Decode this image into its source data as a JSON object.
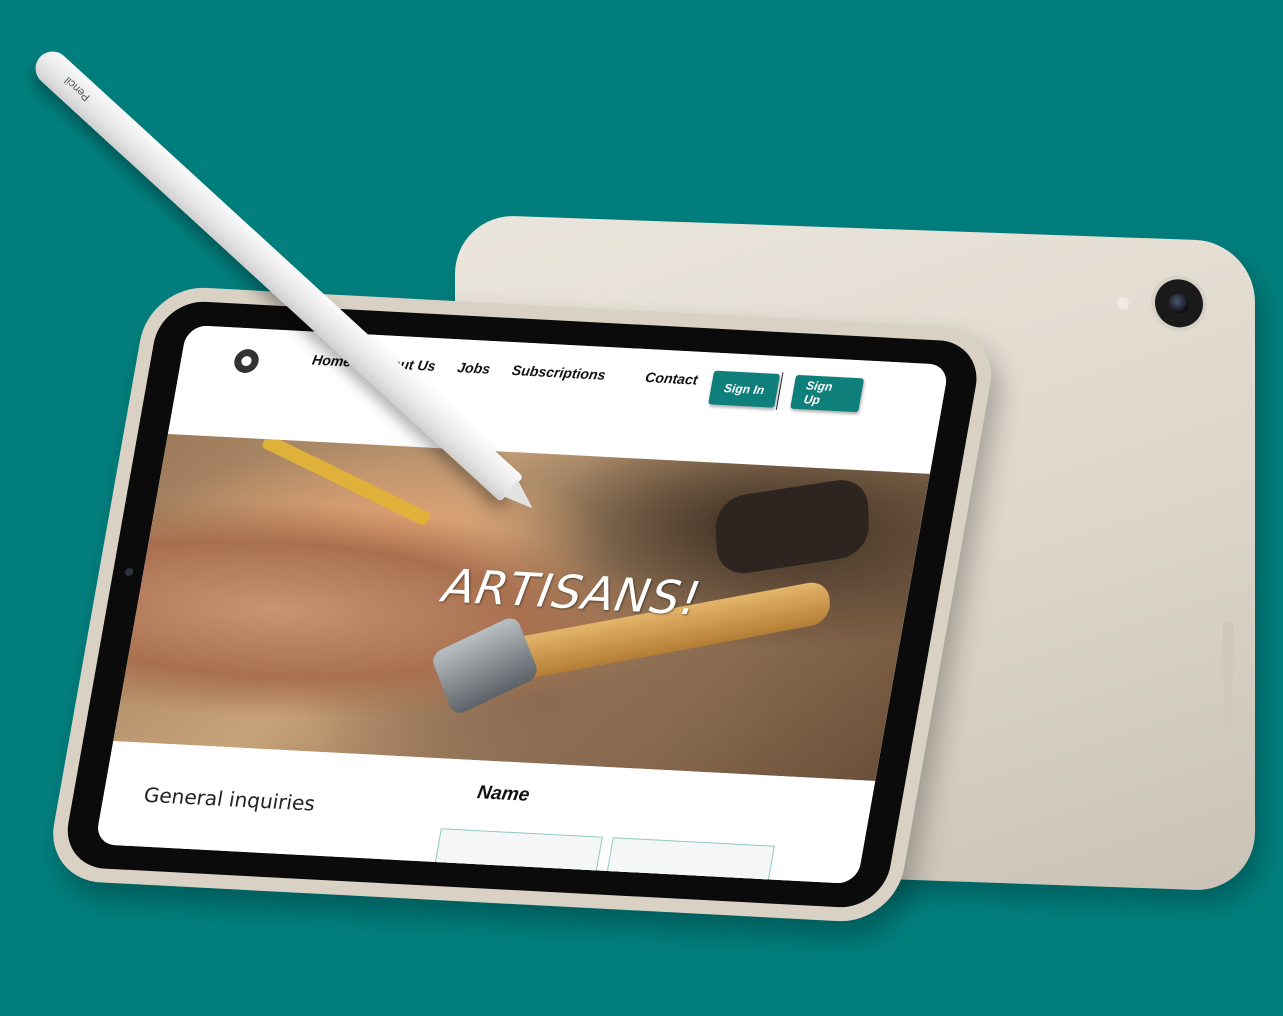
{
  "nav": {
    "links": [
      "Home",
      "About Us",
      "Jobs",
      "Subscriptions",
      "Contact"
    ],
    "sign_in": "Sign In",
    "sign_up": "Sign Up"
  },
  "hero": {
    "title": "ARTISANS!"
  },
  "contact": {
    "inquiries_label": "General inquiries",
    "name_label": "Name"
  },
  "stylus": {
    "brand": "Pencil"
  },
  "colors": {
    "background": "#007f7e",
    "button": "#0f7f7b"
  }
}
